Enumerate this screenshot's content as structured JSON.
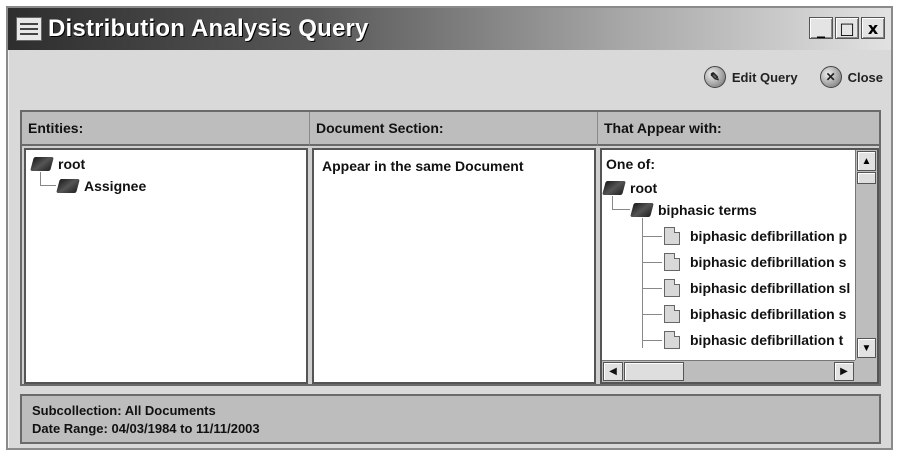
{
  "window": {
    "title": "Distribution Analysis Query",
    "controls": {
      "minimize": "_",
      "maximize": "□",
      "close": "x"
    }
  },
  "toolbar": {
    "edit_query_label": "Edit Query",
    "close_label": "Close"
  },
  "columns": {
    "entities": {
      "header": "Entities:",
      "tree": [
        {
          "label": "root"
        },
        {
          "label": "Assignee"
        }
      ]
    },
    "document_section": {
      "header": "Document Section:",
      "value": "Appear in the same Document"
    },
    "appear_with": {
      "header": "That Appear with:",
      "intro": "One of:",
      "root_label": "root",
      "group_label": "biphasic terms",
      "items": [
        "biphasic defibrillation p",
        "biphasic defibrillation s",
        "biphasic defibrillation sl",
        "biphasic defibrillation s",
        "biphasic defibrillation t"
      ]
    }
  },
  "status": {
    "subcollection": "Subcollection:  All Documents",
    "date_range": "Date Range:  04/03/1984 to 11/11/2003"
  }
}
